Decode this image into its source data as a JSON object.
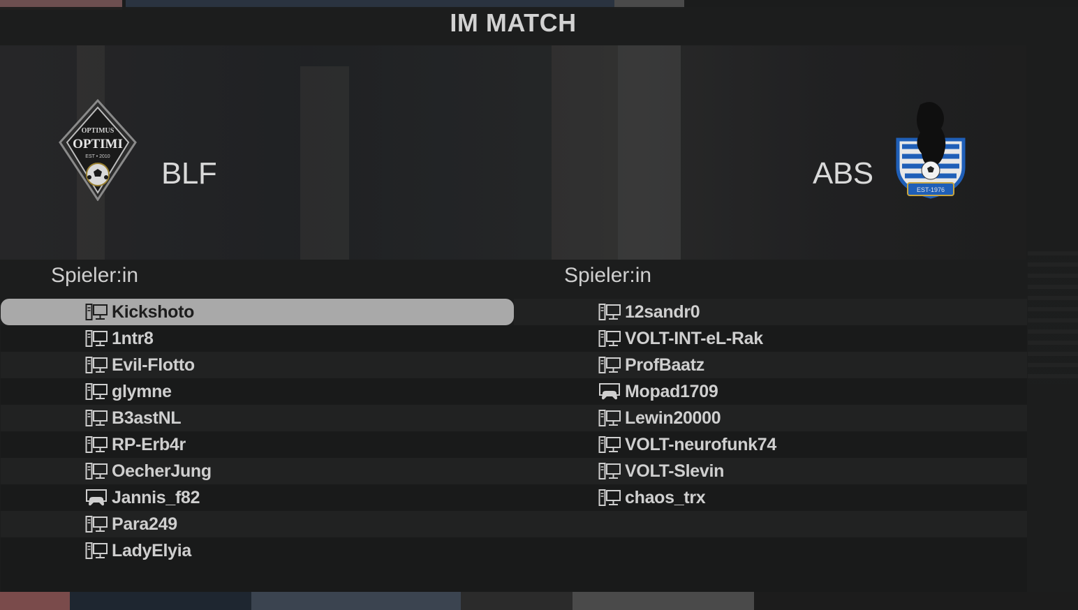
{
  "header": {
    "title": "IM MATCH"
  },
  "home": {
    "team": "BLF",
    "crest": {
      "name": "optimi-crest",
      "top": "OPTIMUS",
      "main": "OPTIMI",
      "est": "EST • 2010"
    },
    "column_header": "Spieler:in",
    "players": [
      {
        "name": "Kickshoto",
        "platform": "pc-icon",
        "selected": true
      },
      {
        "name": "1ntr8",
        "platform": "pc-icon"
      },
      {
        "name": "Evil-Flotto",
        "platform": "pc-icon"
      },
      {
        "name": "glymne",
        "platform": "pc-icon"
      },
      {
        "name": "B3astNL",
        "platform": "pc-icon"
      },
      {
        "name": "RP-Erb4r",
        "platform": "pc-icon"
      },
      {
        "name": "OecherJung",
        "platform": "pc-icon"
      },
      {
        "name": "Jannis_f82",
        "platform": "console-icon"
      },
      {
        "name": "Para249",
        "platform": "pc-icon"
      },
      {
        "name": "LadyElyia",
        "platform": "pc-icon"
      }
    ]
  },
  "away": {
    "team": "ABS",
    "crest": {
      "name": "bear-crest",
      "est": "EST-1976"
    },
    "column_header": "Spieler:in",
    "players": [
      {
        "name": "12sandr0",
        "platform": "pc-icon"
      },
      {
        "name": "VOLT-INT-eL-Rak",
        "platform": "pc-icon"
      },
      {
        "name": "ProfBaatz",
        "platform": "pc-icon"
      },
      {
        "name": "Mopad1709",
        "platform": "console-icon"
      },
      {
        "name": "Lewin20000",
        "platform": "pc-icon"
      },
      {
        "name": "VOLT-neurofunk74",
        "platform": "pc-icon"
      },
      {
        "name": "VOLT-Slevin",
        "platform": "pc-icon"
      },
      {
        "name": "chaos_trx",
        "platform": "pc-icon"
      }
    ]
  },
  "colors": {
    "selected_row": "#a9a9a9",
    "text": "#cfcfcf",
    "away_crest_blue": "#1f5fb8"
  }
}
